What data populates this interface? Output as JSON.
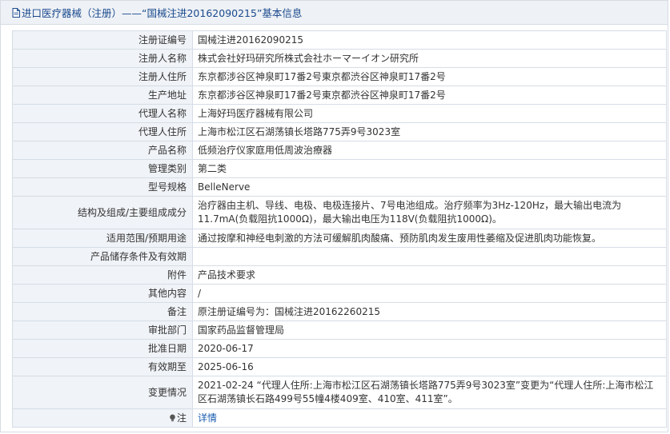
{
  "header": {
    "title": "进口医疗器械（注册）——“国械注进20162090215”基本信息"
  },
  "rows": [
    {
      "label": "注册证编号",
      "value": "国械注进20162090215"
    },
    {
      "label": "注册人名称",
      "value": "株式会社好玛研究所株式会社ホーマーイオン研究所"
    },
    {
      "label": "注册人住所",
      "value": "东京都涉谷区神泉町17番2号東京都渋谷区神泉町17番2号"
    },
    {
      "label": "生产地址",
      "value": "东京都涉谷区神泉町17番2号東京都渋谷区神泉町17番2号"
    },
    {
      "label": "代理人名称",
      "value": "上海好玛医疗器械有限公司"
    },
    {
      "label": "代理人住所",
      "value": "上海市松江区石湖荡镇长塔路775弄9号3023室"
    },
    {
      "label": "产品名称",
      "value": "低频治疗仪家庭用低周波治療器"
    },
    {
      "label": "管理类别",
      "value": "第二类"
    },
    {
      "label": "型号规格",
      "value": "BelleNerve"
    },
    {
      "label": "结构及组成/主要组成成分",
      "value": "治疗器由主机、导线、电极、电极连接片、7号电池组成。治疗频率为3Hz-120Hz，最大输出电流为11.7mA(负载阻抗1000Ω)，最大输出电压为118V(负载阻抗1000Ω)。"
    },
    {
      "label": "适用范围/预期用途",
      "value": "通过按摩和神经电刺激的方法可缓解肌肉酸痛、预防肌肉发生废用性萎缩及促进肌肉功能恢复。"
    },
    {
      "label": "产品储存条件及有效期",
      "value": ""
    },
    {
      "label": "附件",
      "value": "产品技术要求"
    },
    {
      "label": "其他内容",
      "value": "/"
    },
    {
      "label": "备注",
      "value": "原注册证编号为：国械注进20162260215"
    },
    {
      "label": "审批部门",
      "value": "国家药品监督管理局"
    },
    {
      "label": "批准日期",
      "value": "2020-06-17"
    },
    {
      "label": "有效期至",
      "value": "2025-06-16"
    },
    {
      "label": "变更情况",
      "value": "2021-02-24 “代理人住所:上海市松江区石湖荡镇长塔路775弄9号3023室”变更为“代理人住所:上海市松江区石湖荡镇长石路499号55幢4楼409室、410室、411室”。"
    }
  ],
  "note": {
    "label": "注",
    "link_text": "详情"
  }
}
